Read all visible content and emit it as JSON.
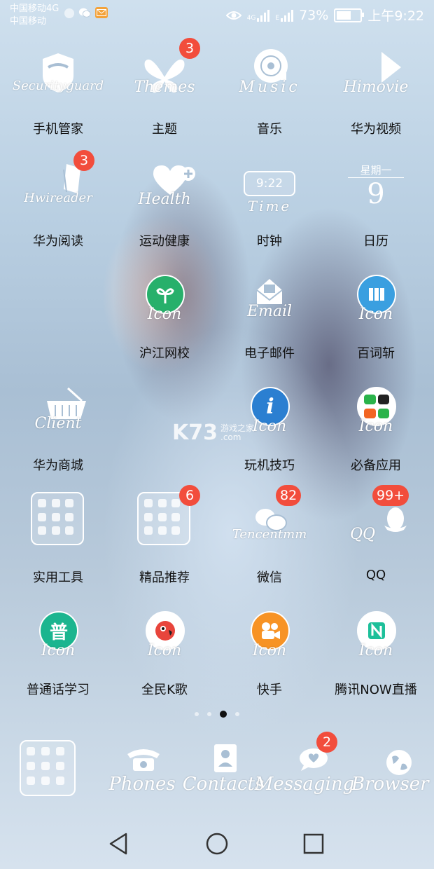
{
  "status_bar": {
    "carrier_1": "中国移动4G",
    "carrier_2": "中国移动",
    "network_label": "4G",
    "signal2_label": "E",
    "battery_percent": "73%",
    "battery_level": 0.73,
    "time": "上午9:22"
  },
  "apps": [
    {
      "label": "手机管家",
      "script": "Securityguard",
      "badge": ""
    },
    {
      "label": "主题",
      "script": "Themes",
      "badge": "3"
    },
    {
      "label": "音乐",
      "script": "Music",
      "badge": ""
    },
    {
      "label": "华为视频",
      "script": "Himovie",
      "badge": ""
    },
    {
      "label": "华为阅读",
      "script": "Hwireader",
      "badge": "3"
    },
    {
      "label": "运动健康",
      "script": "Health",
      "badge": ""
    },
    {
      "label": "时钟",
      "script": "Time",
      "clock_time": "9:22",
      "badge": ""
    },
    {
      "label": "日历",
      "weekday": "星期一",
      "day": "9",
      "badge": ""
    },
    {
      "label": "沪江网校",
      "script": "Icon",
      "badge": ""
    },
    {
      "label": "电子邮件",
      "script": "Email",
      "badge": ""
    },
    {
      "label": "百词斩",
      "script": "Icon",
      "badge": ""
    },
    {
      "label": "华为商城",
      "script": "Client",
      "badge": ""
    },
    {
      "label": "玩机技巧",
      "script": "Icon",
      "badge": ""
    },
    {
      "label": "必备应用",
      "script": "Icon",
      "badge": ""
    },
    {
      "label": "实用工具",
      "badge": ""
    },
    {
      "label": "精品推荐",
      "badge": "6"
    },
    {
      "label": "微信",
      "script": "Tencentmm",
      "badge": "82"
    },
    {
      "label": "QQ",
      "script": "QQ",
      "badge": "99+"
    },
    {
      "label": "普通话学习",
      "script": "Icon",
      "glyph": "普",
      "badge": ""
    },
    {
      "label": "全民K歌",
      "script": "Icon",
      "badge": ""
    },
    {
      "label": "快手",
      "script": "Icon",
      "badge": ""
    },
    {
      "label": "腾讯NOW直播",
      "script": "Icon",
      "badge": ""
    }
  ],
  "watermark": {
    "brand": "K73",
    "text": "游戏之家",
    "domain": ".com"
  },
  "dock": [
    {
      "script": "",
      "badge": ""
    },
    {
      "script": "Phones",
      "badge": ""
    },
    {
      "script": "Contacts",
      "badge": ""
    },
    {
      "script": "Messaging",
      "badge": "2"
    },
    {
      "script": "Browser",
      "badge": ""
    }
  ],
  "colors": {
    "badge": "#f24d3c",
    "label_text": "#111111"
  }
}
